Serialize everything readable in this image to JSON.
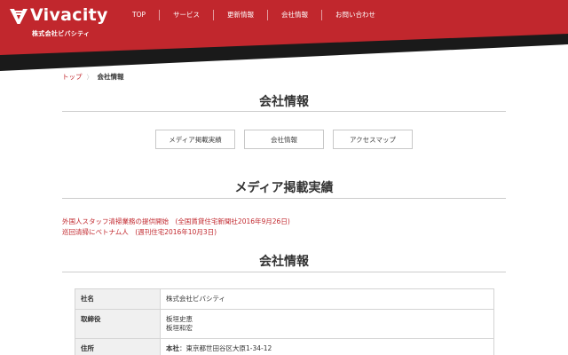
{
  "header": {
    "logo_text": "Vivacity",
    "logo_sub": "株式会社ビバシティ",
    "nav": [
      "TOP",
      "サービス",
      "更新情報",
      "会社情報",
      "お問い合わせ"
    ],
    "colors": {
      "brand_red": "#c1272d",
      "dark": "#1a1a1a"
    }
  },
  "breadcrumb": {
    "home": "トップ",
    "separator": "〉",
    "current": "会社情報"
  },
  "page_title": "会社情報",
  "anchors": [
    "メディア掲載実績",
    "会社情報",
    "アクセスマップ"
  ],
  "media": {
    "title": "メディア掲載実績",
    "items": [
      "外国人スタッフ清掃業務の提供開始　(全国賃貸住宅新聞社2016年9月26日)",
      "巡回清掃にベトナム人　(週刊住宅2016年10月3日)"
    ]
  },
  "company": {
    "title": "会社情報",
    "rows": [
      {
        "label": "社名",
        "lines": [
          "株式会社ビバシティ"
        ]
      },
      {
        "label": "取締役",
        "lines": [
          "板垣史恵",
          "板垣和宏"
        ]
      },
      {
        "label": "住所",
        "addr_label": "本社",
        "addr_sep": "：",
        "addr": "東京都世田谷区大原1-34-12"
      }
    ]
  }
}
